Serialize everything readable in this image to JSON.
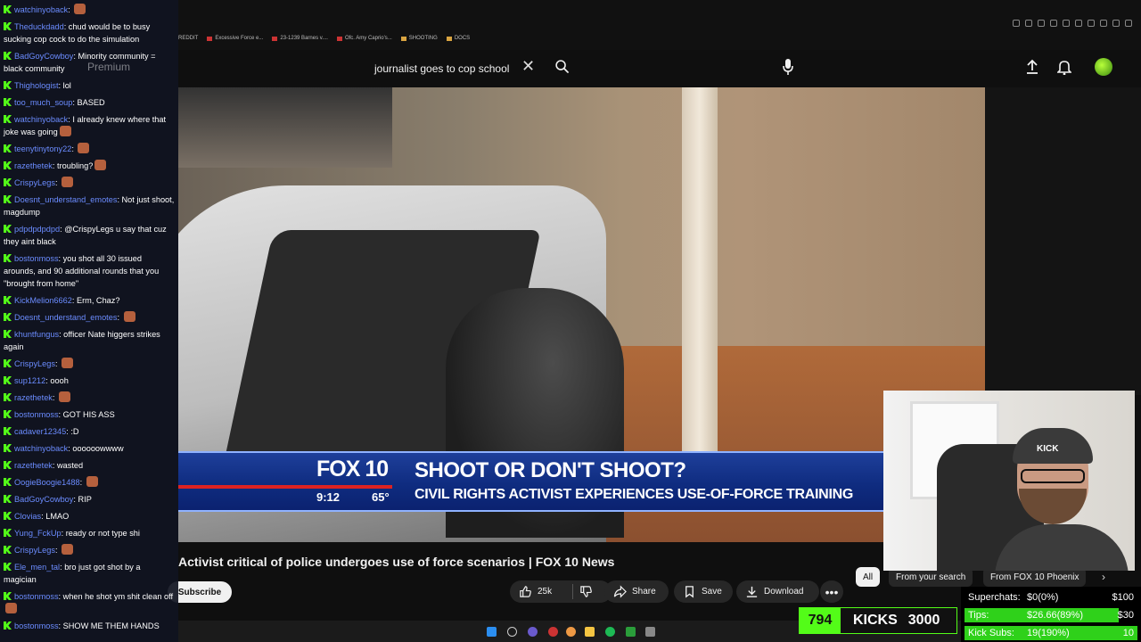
{
  "browser": {
    "bookmarks": [
      "REDDIT",
      "Excessive Force e...",
      "23-1239 Barnes v....",
      "Ofc. Amy Caprio's...",
      "SHOOTING",
      "DOCS"
    ]
  },
  "youtube": {
    "search_query": "journalist goes to cop school",
    "premium_label": "Premium",
    "video_title": "Activist critical of police undergoes use of force scenarios | FOX 10 News",
    "channel_name": "FOX 10 Phoenix",
    "subscribe_label": "Subscribe",
    "like_count": "25k",
    "share_label": "Share",
    "save_label": "Save",
    "download_label": "Download",
    "chips": [
      "All",
      "From your search",
      "From FOX 10 Phoenix"
    ]
  },
  "lower_third": {
    "logo": "FOX 10",
    "time": "9:12",
    "temp": "65°",
    "headline": "SHOOT OR DON'T SHOOT?",
    "subline": "CIVIL RIGHTS ACTIVIST EXPERIENCES USE-OF-FORCE TRAINING"
  },
  "chat": [
    {
      "user": "watchinyoback",
      "text": "",
      "emote": true
    },
    {
      "user": "Theduckdadd",
      "text": "chud would be to busy sucking cop cock to do the simulation"
    },
    {
      "user": "BadGoyCowboy",
      "text": "Minority community = black community"
    },
    {
      "user": "Thighologist",
      "text": "lol"
    },
    {
      "user": "too_much_soup",
      "text": "BASED"
    },
    {
      "user": "watchinyoback",
      "text": "I already knew where that joke was going",
      "emote": true
    },
    {
      "user": "teenytinytony22",
      "text": "",
      "emote": true
    },
    {
      "user": "razethetek",
      "text": "troubling?",
      "emote": true
    },
    {
      "user": "CrispyLegs",
      "text": "",
      "emote": true
    },
    {
      "user": "Doesnt_understand_emotes",
      "text": "Not just shoot, magdump"
    },
    {
      "user": "pdpdpdpdpd",
      "text": "@CrispyLegs u say that cuz they aint black"
    },
    {
      "user": "bostonmoss",
      "text": "you shot all 30 issued arounds, and 90 additional rounds that you \"brought from home\""
    },
    {
      "user": "KickMelion6662",
      "text": "Erm, Chaz?"
    },
    {
      "user": "Doesnt_understand_emotes",
      "text": "",
      "emote": true
    },
    {
      "user": "khuntfungus",
      "text": "officer Nate higgers strikes again"
    },
    {
      "user": "CrispyLegs",
      "text": "",
      "emote": true
    },
    {
      "user": "sup1212",
      "text": "oooh"
    },
    {
      "user": "razethetek",
      "text": "",
      "emote": true
    },
    {
      "user": "bostonmoss",
      "text": "GOT HIS ASS"
    },
    {
      "user": "cadaver12345",
      "text": ":D"
    },
    {
      "user": "watchinyoback",
      "text": "oooooowwww"
    },
    {
      "user": "razethetek",
      "text": "wasted"
    },
    {
      "user": "OogieBoogie1488",
      "text": "",
      "emote": true
    },
    {
      "user": "BadGoyCowboy",
      "text": "RIP"
    },
    {
      "user": "Clovias",
      "text": "LMAO"
    },
    {
      "user": "Yung_FckUp",
      "text": "ready or not type shi"
    },
    {
      "user": "CrispyLegs",
      "text": "",
      "emote": true
    },
    {
      "user": "Ele_men_tal",
      "text": "bro just got shot by a magician"
    },
    {
      "user": "bostonmoss",
      "text": "when he shot ym shit clean off",
      "emote": true
    },
    {
      "user": "bostonmoss",
      "text": "SHOW ME THEM HANDS"
    }
  ],
  "webcam": {
    "beanie_text": "KICK"
  },
  "kicks": {
    "count": "794",
    "label": "KICKS",
    "goal": "3000"
  },
  "goals": [
    {
      "label": "Superchats:",
      "value": "$0(0%)",
      "target": "$100",
      "progress": 0
    },
    {
      "label": "Tips:",
      "value": "$26.66(89%)",
      "target": "$30",
      "progress": 0.89
    },
    {
      "label": "Kick Subs:",
      "value": "19(190%)",
      "target": "10",
      "progress": 1.0
    }
  ],
  "colors": {
    "kick_green": "#53fc18",
    "chat_user": "#6b8cff",
    "fox_blue": "#0f2c80"
  }
}
